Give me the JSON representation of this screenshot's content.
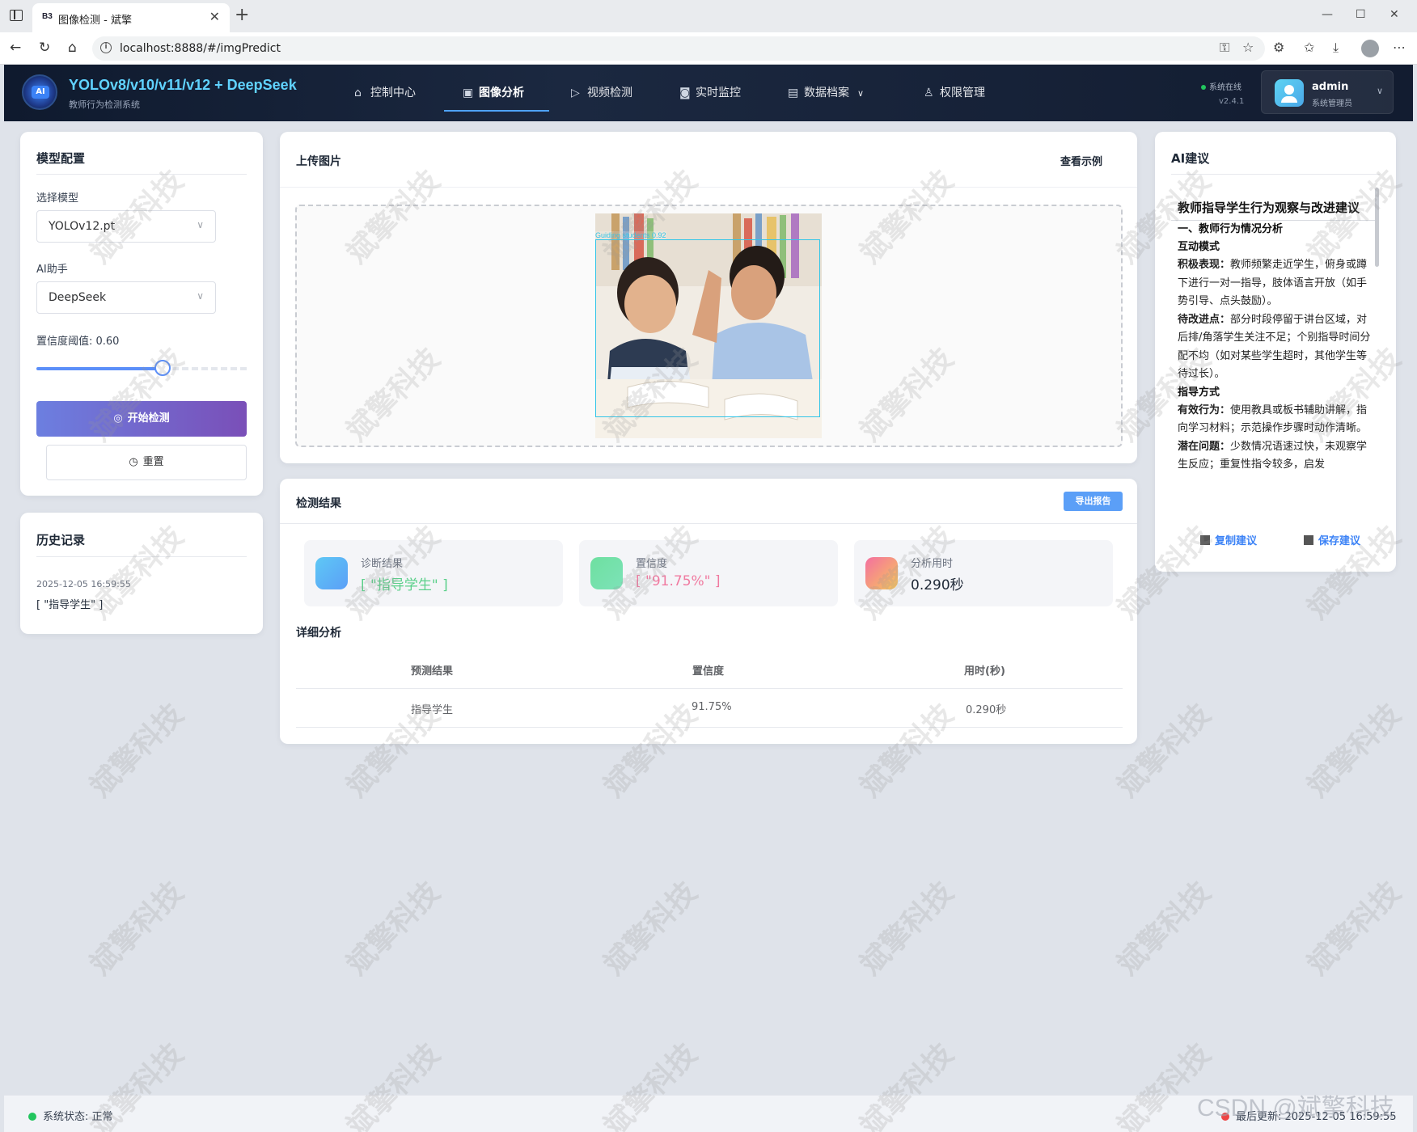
{
  "browser": {
    "tab_title": "图像检测 - 斌擎",
    "favicon_text": "B3",
    "url": "localhost:8888/#/imgPredict"
  },
  "header": {
    "title": "YOLOv8/v10/v11/v12 + DeepSeek",
    "subtitle": "教师行为检测系统",
    "nav": [
      "控制中心",
      "图像分析",
      "视频检测",
      "实时监控",
      "数据档案",
      "权限管理"
    ],
    "status": "系统在线",
    "version": "v2.4.1",
    "user_name": "admin",
    "user_role": "系统管理员"
  },
  "model_config": {
    "title": "模型配置",
    "model_label": "选择模型",
    "model_value": "YOLOv12.pt",
    "assistant_label": "AI助手",
    "assistant_value": "DeepSeek",
    "threshold_label": "置信度阈值: 0.60",
    "threshold_fraction": 0.6,
    "start_button": "开始检测",
    "reset_button": "重置"
  },
  "history": {
    "title": "历史记录",
    "time": "2025-12-05 16:59:55",
    "value": "[ \"指导学生\" ]"
  },
  "upload": {
    "title": "上传图片",
    "example_link": "查看示例",
    "detection_label": "Guiding students 0.92"
  },
  "results": {
    "title": "检测结果",
    "export_button": "导出报告",
    "stats": [
      {
        "label": "诊断结果",
        "value": "[ \"指导学生\" ]",
        "color": "#5bd08a"
      },
      {
        "label": "置信度",
        "value": "[ \"91.75%\" ]",
        "color": "#f07aa0"
      },
      {
        "label": "分析用时",
        "value": "0.290秒",
        "color": "#1f2937"
      }
    ],
    "detail_title": "详细分析",
    "table": {
      "headers": [
        "预测结果",
        "置信度",
        "用时(秒)"
      ],
      "row": [
        "指导学生",
        "91.75%",
        "0.290秒"
      ]
    }
  },
  "ai": {
    "title": "AI建议",
    "heading": "教师指导学生行为观察与改进建议",
    "section1": "一、教师行为情况分析",
    "sub1": "互动模式",
    "p1_label": "积极表现：",
    "p1_text": "教师频繁走近学生，俯身或蹲下进行一对一指导，肢体语言开放（如手势引导、点头鼓励）。",
    "p2_label": "待改进点：",
    "p2_text": "部分时段停留于讲台区域，对后排/角落学生关注不足；个别指导时间分配不均（如对某些学生超时，其他学生等待过长）。",
    "sub2": "指导方式",
    "p3_label": "有效行为：",
    "p3_text": "使用教具或板书辅助讲解，指向学习材料；示范操作步骤时动作清晰。",
    "p4_label": "潜在问题：",
    "p4_text": "少数情况语速过快，未观察学生反应；重复性指令较多，启发",
    "copy_link": "复制建议",
    "save_link": "保存建议"
  },
  "footer": {
    "status": "系统状态: 正常",
    "last_update": "最后更新: 2025-12-05 16:59:55",
    "csdn": "CSDN @斌擎科技"
  },
  "watermark": "斌擎科技"
}
